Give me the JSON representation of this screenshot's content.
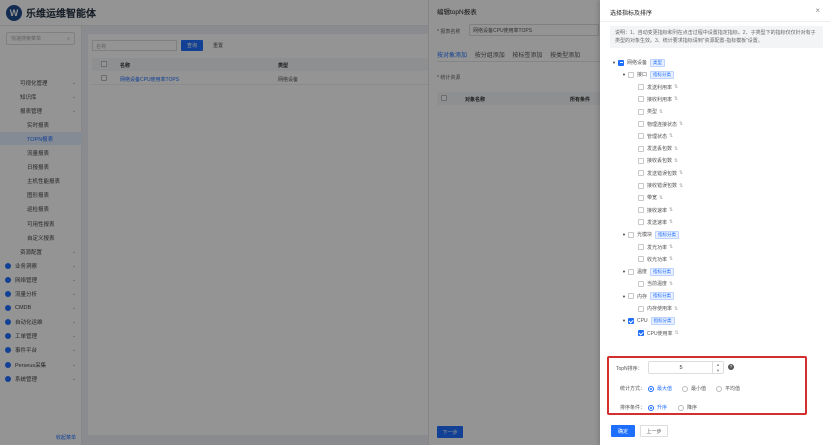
{
  "app": {
    "title": "乐维运维智能体",
    "logo_char": "W"
  },
  "sidebar": {
    "search_placeholder": "快速搜索菜单",
    "items": [
      {
        "label": "可视化管理",
        "level": 2,
        "expanded": true
      },
      {
        "label": "知识库",
        "level": 2,
        "expanded": true
      },
      {
        "label": "报表管理",
        "level": 2,
        "expanded": true
      },
      {
        "label": "实时报表",
        "level": 3
      },
      {
        "label": "TOPN报表",
        "level": 3,
        "selected": true
      },
      {
        "label": "流量报表",
        "level": 3
      },
      {
        "label": "日报报表",
        "level": 3
      },
      {
        "label": "主机性能报表",
        "level": 3
      },
      {
        "label": "图形报表",
        "level": 3
      },
      {
        "label": "巡检报表",
        "level": 3
      },
      {
        "label": "可用性报表",
        "level": 3
      },
      {
        "label": "自定义报表",
        "level": 3
      },
      {
        "label": "资源配置",
        "level": 2,
        "expanded": true
      },
      {
        "label": "业务洞察",
        "level": 1
      },
      {
        "label": "网络管理",
        "level": 1
      },
      {
        "label": "流量分析",
        "level": 1
      },
      {
        "label": "CMDB",
        "level": 1
      },
      {
        "label": "自动化运维",
        "level": 1
      },
      {
        "label": "工单管理",
        "level": 1
      },
      {
        "label": "事件平台",
        "level": 1
      },
      {
        "label": "Perseus采集",
        "level": 1
      },
      {
        "label": "系统管理",
        "level": 1
      }
    ],
    "bottom_text": "收起菜单"
  },
  "main": {
    "filter_placeholder": "名称",
    "query_btn": "查询",
    "reset_btn": "重置",
    "columns": [
      "名称",
      "类型"
    ],
    "rows": [
      {
        "name": "网络设备CPU使用率TOPS",
        "type": "网络设备"
      }
    ]
  },
  "middle": {
    "title": "编辑topN报表",
    "name_label": "* 报表名称",
    "name_value": "网络设备CPU使用率TOPS",
    "tabs": [
      "按对象添加",
      "按分组添加",
      "按标签添加",
      "按类型添加"
    ],
    "active_tab": 0,
    "stat_label": "* 统计资源",
    "table_columns": [
      "对象名称",
      "所有条件"
    ],
    "next_btn": "下一步"
  },
  "drawer": {
    "title": "选择指标及排序",
    "close": "×",
    "description": "说明：1、自动变更指标和列在点击过程中设置指定指标。2、子类型下的指标仅仅针对有子类型的对象生效。3、统计要求指标请到“资源配置-指标模板”设置。",
    "tree": [
      {
        "label": "网络设备",
        "tag": "类型",
        "depth": 0,
        "toggle": "▼",
        "check": "half"
      },
      {
        "label": "接口",
        "tag": "指标分类",
        "depth": 1,
        "toggle": "▼",
        "check": "off"
      },
      {
        "label": "发送利用率",
        "depth": 2,
        "check": "off",
        "sort": true
      },
      {
        "label": "接收利用率",
        "depth": 2,
        "check": "off",
        "sort": true
      },
      {
        "label": "类型",
        "depth": 2,
        "check": "off",
        "sort": true
      },
      {
        "label": "物理连接状态",
        "depth": 2,
        "check": "off",
        "sort": true
      },
      {
        "label": "管理状态",
        "depth": 2,
        "check": "off",
        "sort": true
      },
      {
        "label": "发送丢包数",
        "depth": 2,
        "check": "off",
        "sort": true
      },
      {
        "label": "接收丢包数",
        "depth": 2,
        "check": "off",
        "sort": true
      },
      {
        "label": "发送错误包数",
        "depth": 2,
        "check": "off",
        "sort": true
      },
      {
        "label": "接收错误包数",
        "depth": 2,
        "check": "off",
        "sort": true
      },
      {
        "label": "带宽",
        "depth": 2,
        "check": "off",
        "sort": true
      },
      {
        "label": "接收速率",
        "depth": 2,
        "check": "off",
        "sort": true
      },
      {
        "label": "发送速率",
        "depth": 2,
        "check": "off",
        "sort": true
      },
      {
        "label": "光模块",
        "tag": "指标分类",
        "depth": 1,
        "toggle": "▼",
        "check": "off"
      },
      {
        "label": "发光功率",
        "depth": 2,
        "check": "off",
        "sort": true
      },
      {
        "label": "收光功率",
        "depth": 2,
        "check": "off",
        "sort": true
      },
      {
        "label": "温度",
        "tag": "指标分类",
        "depth": 1,
        "toggle": "▼",
        "check": "off"
      },
      {
        "label": "当前温度",
        "depth": 2,
        "check": "off",
        "sort": true
      },
      {
        "label": "内存",
        "tag": "指标分类",
        "depth": 1,
        "toggle": "▼",
        "check": "off"
      },
      {
        "label": "内存使用率",
        "depth": 2,
        "check": "off",
        "sort": true
      },
      {
        "label": "CPU",
        "tag": "指标分类",
        "depth": 1,
        "toggle": "▼",
        "check": "on"
      },
      {
        "label": "CPU使用率",
        "depth": 2,
        "check": "on",
        "sort": true
      }
    ],
    "topn_label": "TopN排序：",
    "topn_value": "5",
    "stat_mode_label": "统计方式：",
    "stat_modes": [
      "最大值",
      "最小值",
      "平均值"
    ],
    "stat_mode_selected": 0,
    "order_label": "排序条件：",
    "orders": [
      "升序",
      "降序"
    ],
    "order_selected": 0,
    "confirm_btn": "确定",
    "prev_btn": "上一步"
  },
  "colors": {
    "accent": "#1f6fff",
    "highlight_box": "#d32f2f"
  },
  "icons": {
    "sort": "sort-icon",
    "help": "help-icon",
    "search": "search-icon"
  }
}
